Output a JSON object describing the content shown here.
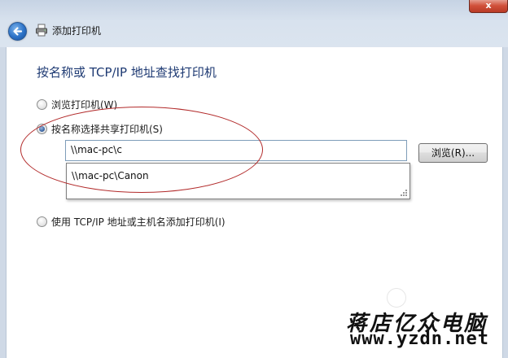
{
  "window": {
    "title": "添加打印机",
    "close_label": "x"
  },
  "heading": "按名称或 TCP/IP 地址查找打印机",
  "options": {
    "browse_printer": "浏览打印机(W)",
    "select_shared": "按名称选择共享打印机(S)",
    "tcpip": "使用 TCP/IP 地址或主机名添加打印机(I)"
  },
  "selected_option": "select_shared",
  "share_input": {
    "value": "\\\\mac-pc\\c"
  },
  "browse_button": "浏览(R)...",
  "suggestions": [
    "\\\\mac-pc\\Canon"
  ],
  "watermark": {
    "cn": "蒋店亿众电脑",
    "url": "www.yzdn.net"
  },
  "colors": {
    "heading": "#1e3a73",
    "annotation_ellipse": "#b22a2a",
    "input_border": "#7f9db9"
  },
  "icons": [
    "back-arrow-icon",
    "printer-icon",
    "close-icon",
    "resize-grip-icon"
  ]
}
